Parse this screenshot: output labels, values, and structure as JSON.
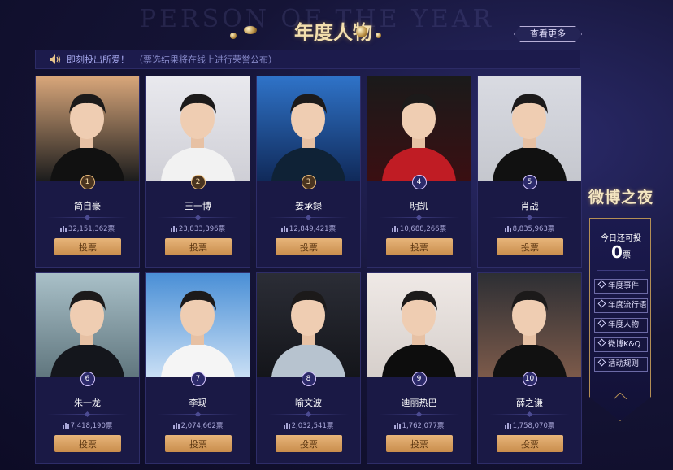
{
  "header": {
    "bg_text": "PERSON OF THE YEAR",
    "title": "年度人物",
    "view_more": "查看更多"
  },
  "notice": {
    "icon": "speaker-icon",
    "text": "即刻投出所爱！",
    "subtext": "（票选结果将在线上进行荣誉公布）"
  },
  "vote_button_label": "投票",
  "candidates": [
    {
      "rank": "1",
      "name": "简自豪",
      "votes": "32,151,362票"
    },
    {
      "rank": "2",
      "name": "王一博",
      "votes": "23,833,396票"
    },
    {
      "rank": "3",
      "name": "姜承録",
      "votes": "12,849,421票"
    },
    {
      "rank": "4",
      "name": "明凯",
      "votes": "10,688,266票"
    },
    {
      "rank": "5",
      "name": "肖战",
      "votes": "8,835,963票"
    },
    {
      "rank": "6",
      "name": "朱一龙",
      "votes": "7,418,190票"
    },
    {
      "rank": "7",
      "name": "李现",
      "votes": "2,074,662票"
    },
    {
      "rank": "8",
      "name": "喻文波",
      "votes": "2,032,541票"
    },
    {
      "rank": "9",
      "name": "迪丽热巴",
      "votes": "1,762,077票"
    },
    {
      "rank": "10",
      "name": "薛之谦",
      "votes": "1,758,070票"
    }
  ],
  "side_panel": {
    "logo": "微博之夜",
    "remaining_label": "今日还可投",
    "remaining_count": "0",
    "remaining_unit": "票",
    "nav": [
      "年度事件",
      "年度流行语",
      "年度人物",
      "微博K&Q",
      "活动规则"
    ]
  },
  "colors": {
    "background": "#151436",
    "card": "#1a1945",
    "gold": "#e7b57a",
    "accent_text": "#a7a9ef"
  }
}
